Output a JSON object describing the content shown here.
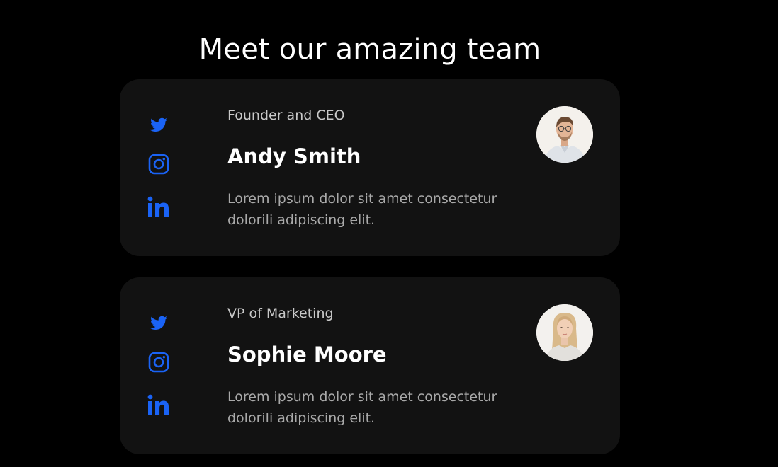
{
  "page": {
    "title": "Meet our amazing team"
  },
  "colors": {
    "background": "#000000",
    "card": "#121212",
    "accent_blue": "#1a63f5",
    "name": "#ffffff",
    "role": "#c9c9c9",
    "bio": "#a9a9a9"
  },
  "team": [
    {
      "role": "Founder and CEO",
      "name": "Andy Smith",
      "bio": "Lorem ipsum dolor sit amet consectetur dolorili adipiscing elit.",
      "icons": [
        "twitter-icon",
        "instagram-icon",
        "linkedin-icon"
      ]
    },
    {
      "role": "VP of Marketing",
      "name": "Sophie Moore",
      "bio": "Lorem ipsum dolor sit amet consectetur dolorili adipiscing elit.",
      "icons": [
        "twitter-icon",
        "instagram-icon",
        "linkedin-icon"
      ]
    }
  ]
}
